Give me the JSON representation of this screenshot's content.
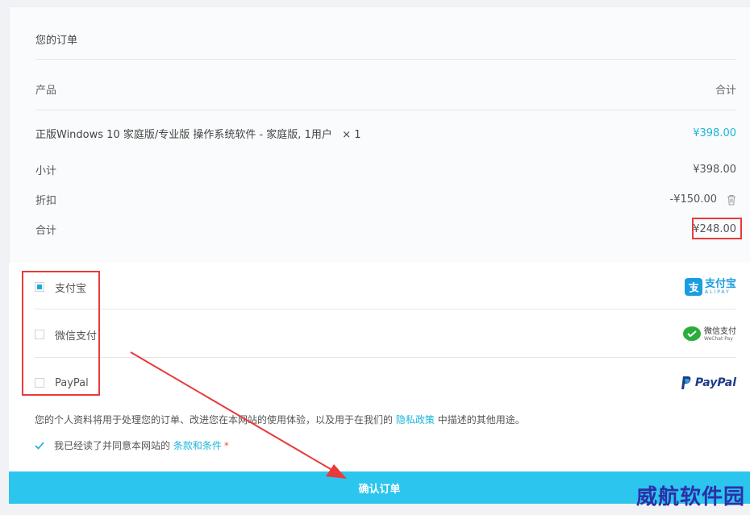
{
  "order": {
    "title": "您的订单",
    "col_product": "产品",
    "col_total": "合计",
    "item_name": "正版Windows 10 家庭版/专业版 操作系统软件 - 家庭版, 1用户",
    "item_qty": "× 1",
    "item_price": "¥398.00",
    "subtotal_label": "小计",
    "subtotal_value": "¥398.00",
    "discount_label": "折扣",
    "discount_value": "-¥150.00",
    "total_label": "合计",
    "total_value": "¥248.00"
  },
  "payment": {
    "methods": [
      {
        "label": "支付宝",
        "checked": true,
        "logo_text": "支付宝",
        "logo_sub": "ALIPAY",
        "icon": "alipay-logo"
      },
      {
        "label": "微信支付",
        "checked": false,
        "logo_text": "微信支付",
        "logo_sub": "WeChat Pay",
        "icon": "wechat-pay-logo"
      },
      {
        "label": "PayPal",
        "checked": false,
        "logo_text": "PayPal",
        "icon": "paypal-logo"
      }
    ]
  },
  "privacy": {
    "text_before": "您的个人资料将用于处理您的订单、改进您在本网站的使用体验，以及用于在我们的",
    "link": "隐私政策",
    "text_after": "中描述的其他用途。"
  },
  "terms": {
    "checked": true,
    "text": "我已经读了并同意本网站的",
    "link": "条款和条件",
    "required_mark": "*"
  },
  "submit_label": "确认订单",
  "watermark": "威航软件园",
  "colors": {
    "accent": "#1db5d9",
    "button": "#2bc5ee",
    "annotation": "#e83a3a"
  }
}
